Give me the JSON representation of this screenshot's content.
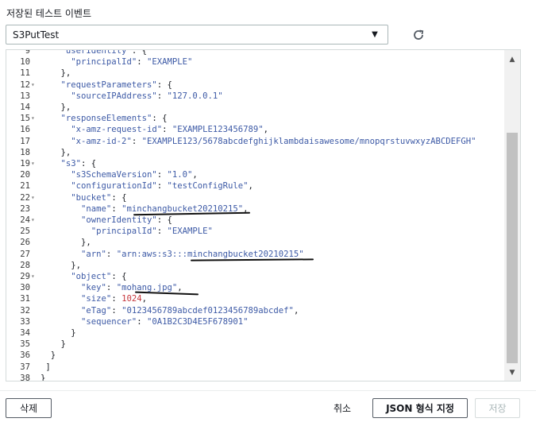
{
  "section": {
    "label": "저장된 테스트 이벤트"
  },
  "event_select": {
    "value": "S3PutTest"
  },
  "editor": {
    "lines": [
      {
        "num": "9",
        "fold": "",
        "code": "    \"userIdentity\": {"
      },
      {
        "num": "10",
        "fold": "",
        "code": "      \"principalId\": \"EXAMPLE\""
      },
      {
        "num": "11",
        "fold": "",
        "code": "    },"
      },
      {
        "num": "12",
        "fold": "▾",
        "code": "    \"requestParameters\": {"
      },
      {
        "num": "13",
        "fold": "",
        "code": "      \"sourceIPAddress\": \"127.0.0.1\""
      },
      {
        "num": "14",
        "fold": "",
        "code": "    },"
      },
      {
        "num": "15",
        "fold": "▾",
        "code": "    \"responseElements\": {"
      },
      {
        "num": "16",
        "fold": "",
        "code": "      \"x-amz-request-id\": \"EXAMPLE123456789\","
      },
      {
        "num": "17",
        "fold": "",
        "code": "      \"x-amz-id-2\": \"EXAMPLE123/5678abcdefghijklambdaisawesome/mnopqrstuvwxyzABCDEFGH\""
      },
      {
        "num": "18",
        "fold": "",
        "code": "    },"
      },
      {
        "num": "19",
        "fold": "▾",
        "code": "    \"s3\": {"
      },
      {
        "num": "20",
        "fold": "",
        "code": "      \"s3SchemaVersion\": \"1.0\","
      },
      {
        "num": "21",
        "fold": "",
        "code": "      \"configurationId\": \"testConfigRule\","
      },
      {
        "num": "22",
        "fold": "▾",
        "code": "      \"bucket\": {"
      },
      {
        "num": "23",
        "fold": "",
        "code": "        \"name\": \"minchangbucket20210215\","
      },
      {
        "num": "24",
        "fold": "▾",
        "code": "        \"ownerIdentity\": {"
      },
      {
        "num": "25",
        "fold": "",
        "code": "          \"principalId\": \"EXAMPLE\""
      },
      {
        "num": "26",
        "fold": "",
        "code": "        },"
      },
      {
        "num": "27",
        "fold": "",
        "code": "        \"arn\": \"arn:aws:s3:::minchangbucket20210215\""
      },
      {
        "num": "28",
        "fold": "",
        "code": "      },"
      },
      {
        "num": "29",
        "fold": "▾",
        "code": "      \"object\": {"
      },
      {
        "num": "30",
        "fold": "",
        "code": "        \"key\": \"mohang.jpg\","
      },
      {
        "num": "31",
        "fold": "",
        "code": "        \"size\": 1024,"
      },
      {
        "num": "32",
        "fold": "",
        "code": "        \"eTag\": \"0123456789abcdef0123456789abcdef\","
      },
      {
        "num": "33",
        "fold": "",
        "code": "        \"sequencer\": \"0A1B2C3D4E5F678901\""
      },
      {
        "num": "34",
        "fold": "",
        "code": "      }"
      },
      {
        "num": "35",
        "fold": "",
        "code": "    }"
      },
      {
        "num": "36",
        "fold": "",
        "code": "  }"
      },
      {
        "num": "37",
        "fold": "",
        "code": " ]"
      },
      {
        "num": "38",
        "fold": "",
        "code": "}"
      }
    ]
  },
  "footer": {
    "delete_label": "삭제",
    "cancel_label": "취소",
    "format_label": "JSON 형식 지정",
    "save_label": "저장"
  },
  "icons": {
    "dropdown": "caret-down-icon",
    "refresh": "refresh-icon"
  }
}
